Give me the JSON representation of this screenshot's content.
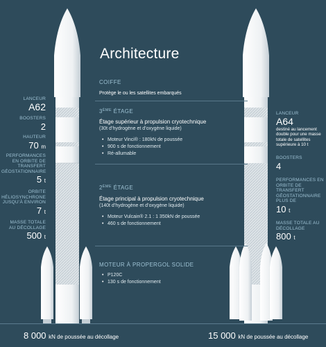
{
  "title": "Architecture",
  "sections": {
    "coiffe": {
      "title": "COIFFE",
      "desc": "Protège le ou les satellites embarqués"
    },
    "third_stage": {
      "title_num": "3",
      "title_sup": "ÈME",
      "title_rest": " ÉTAGE",
      "desc": "Étage supérieur à propulsion cryotechnique",
      "sub": "(30t d’hydrogène et d’oxygène liquide)",
      "bullets": [
        "Moteur Vinci® : 180kN de poussée",
        "900 s de fonctionnement",
        "Ré-allumable"
      ]
    },
    "second_stage": {
      "title_num": "2",
      "title_sup": "ÈME",
      "title_rest": " ÉTAGE",
      "desc": "Étage principal à propulsion cryotechnique",
      "sub": "(140t d’hydrogène et d’oxygène liquide)",
      "bullets": [
        "Moteur Vulcain® 2.1 : 1 350kN de poussée",
        "460 s de fonctionnement"
      ]
    },
    "solid_motor": {
      "title": "MOTEUR À PROPERGOL SOLIDE",
      "bullets": [
        "P120C",
        "130 s de fonctionnement"
      ]
    }
  },
  "left": {
    "lanceur_label": "LANCEUR",
    "lanceur_value": "A62",
    "boosters_label": "BOOSTERS",
    "boosters_value": "2",
    "hauteur_label": "HAUTEUR",
    "hauteur_value": "70",
    "hauteur_unit": "m",
    "perf_gto_label": "PERFORMANCES EN ORBITE DE TRANSFERT GÉOSTATIONNAIRE",
    "perf_gto_value": "5",
    "perf_gto_unit": "t",
    "perf_sso_label": "ORBITE HÉLIOSYNCHRONE JUSQU’À ENVIRON",
    "perf_sso_value": "7",
    "perf_sso_unit": "t",
    "mass_label": "MASSE TOTALE AU DÉCOLLAGE",
    "mass_value": "500",
    "mass_unit": "t"
  },
  "right": {
    "lanceur_label": "LANCEUR",
    "lanceur_value": "A64",
    "lanceur_desc": "destiné au lancement double pour une masse totale de satellites supérieure à 10 t",
    "boosters_label": "BOOSTERS",
    "boosters_value": "4",
    "perf_gto_label": "PERFORMANCES EN ORBITE DE TRANSFERT GÉOSTATIONNAIRE PLUS DE",
    "perf_gto_value": "10",
    "perf_gto_unit": "t",
    "mass_label": "MASSE TOTALE AU DÉCOLLAGE",
    "mass_value": "800",
    "mass_unit": "t"
  },
  "footer": {
    "left_value": "8 000",
    "left_unit": "kN de poussée au décollage",
    "right_value": "15 000",
    "right_unit": "kN de poussée au décollage"
  },
  "colors": {
    "background": "#2e4b5b",
    "rocket_body": "#f2f4f5",
    "rocket_shade": "#c9d2d8",
    "accent_label": "#9ec2d4"
  }
}
